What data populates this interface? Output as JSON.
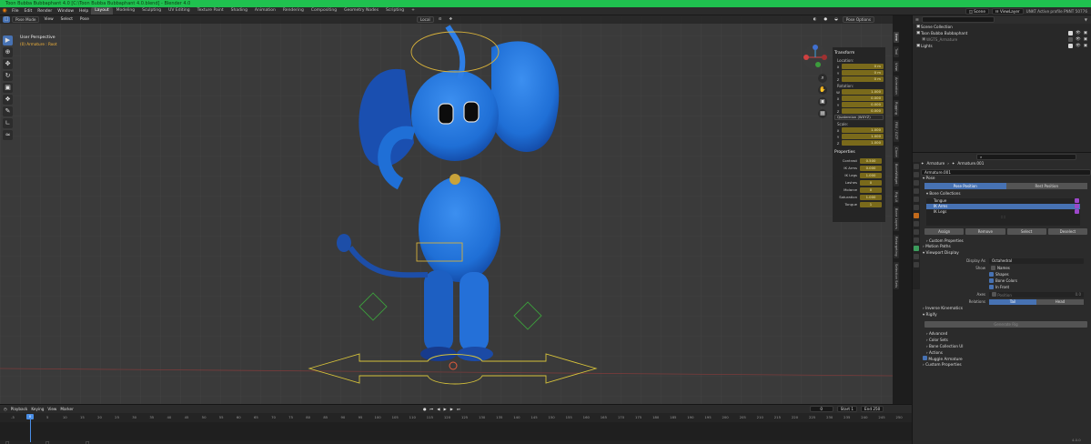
{
  "titlebar": {
    "title": "Toon Bubba Bubbaphant 4.0 [C:\\Toon Bubba Bubbaphant 4.0.blend] - Blender 4.0"
  },
  "menubar": {
    "menus": [
      "File",
      "Edit",
      "Render",
      "Window",
      "Help"
    ],
    "workspaces": [
      "Layout",
      "Modeling",
      "Sculpting",
      "UV Editing",
      "Texture Paint",
      "Shading",
      "Animation",
      "Rendering",
      "Compositing",
      "Geometry Nodes",
      "Scripting"
    ],
    "active_workspace": "Layout",
    "add_tab": "+",
    "scene": "Scene",
    "view_layer": "ViewLayer",
    "status": "UNKT Active profile PNNT 50776"
  },
  "viewport": {
    "mode": "Pose Mode",
    "header_menus": [
      "View",
      "Select",
      "Pose"
    ],
    "transform_orientation": "Local",
    "pose_options": "Pose Options",
    "perspective": "User Perspective",
    "active_object": "(0) Armature : Root",
    "tools": [
      "select",
      "cursor",
      "move",
      "rotate",
      "scale",
      "transform",
      "annotate",
      "measure",
      "relax"
    ]
  },
  "npanel": {
    "transform_title": "Transform",
    "location_label": "Location:",
    "location": [
      {
        "k": "X",
        "v": "0 m"
      },
      {
        "k": "Y",
        "v": "0 m"
      },
      {
        "k": "Z",
        "v": "0 m"
      }
    ],
    "rotation_label": "Rotation:",
    "rotation": [
      {
        "k": "W",
        "v": "1.000"
      },
      {
        "k": "X",
        "v": "0.000"
      },
      {
        "k": "Y",
        "v": "0.000"
      },
      {
        "k": "Z",
        "v": "0.000"
      }
    ],
    "rotation_mode": "Quaternion (WXYZ)",
    "scale_label": "Scale:",
    "scale": [
      {
        "k": "X",
        "v": "1.000"
      },
      {
        "k": "Y",
        "v": "1.000"
      },
      {
        "k": "Z",
        "v": "1.000"
      }
    ],
    "properties_title": "Properties",
    "properties": [
      {
        "k": "Contrast",
        "v": "0.500"
      },
      {
        "k": "IK Arms",
        "v": "0.000"
      },
      {
        "k": "IK Legs",
        "v": "1.000"
      },
      {
        "k": "Lashes",
        "v": "0"
      },
      {
        "k": "Molarce",
        "v": "0"
      },
      {
        "k": "Saturation",
        "v": "1.000"
      },
      {
        "k": "Tongue",
        "v": "1"
      }
    ],
    "tabs": [
      "Item",
      "Tool",
      "View",
      "Animation",
      "Rigging",
      "FBX / GLTF",
      "Clone",
      "BoneWidget",
      "Rig UI",
      "Bone Layers",
      "Retargeting",
      "Selection Sets"
    ],
    "active_tab": "Item"
  },
  "timeline": {
    "menus": [
      "Playback",
      "Keying",
      "View",
      "Marker"
    ],
    "current_frame": "0",
    "start_label": "Start",
    "start": "1",
    "end_label": "End",
    "end": "250",
    "ticks": [
      "-5",
      "0",
      "5",
      "10",
      "15",
      "20",
      "25",
      "30",
      "35",
      "40",
      "45",
      "50",
      "55",
      "60",
      "65",
      "70",
      "75",
      "80",
      "85",
      "90",
      "95",
      "100",
      "105",
      "110",
      "115",
      "120",
      "125",
      "130",
      "135",
      "140",
      "145",
      "150",
      "155",
      "160",
      "165",
      "170",
      "175",
      "180",
      "185",
      "190",
      "195",
      "200",
      "205",
      "210",
      "215",
      "220",
      "225",
      "230",
      "235",
      "240",
      "245",
      "250",
      "255"
    ],
    "playhead_label": "0",
    "version": "4.0.0"
  },
  "outliner": {
    "root": "Scene Collection",
    "items": [
      {
        "name": "Toon Bubba Bubbaphant",
        "icon": "collection-icon",
        "sub": false
      },
      {
        "name": "WGTS_Armature",
        "icon": "collection-icon",
        "sub": true
      },
      {
        "name": "Lights",
        "icon": "collection-icon",
        "sub": false
      }
    ]
  },
  "properties": {
    "breadcrumb": [
      "Armature",
      "Armature.001"
    ],
    "data_name": "Armature.001",
    "pose_section": "Pose",
    "pose_position": "Pose Position",
    "rest_position": "Rest Position",
    "bone_collections_title": "Bone Collections",
    "bone_collections": [
      "Tongue",
      "IK Arms",
      "IK Legs"
    ],
    "selected_collection": "IK Arms",
    "list_dots": "::::",
    "buttons": [
      "Assign",
      "Remove",
      "Select",
      "Deselect"
    ],
    "custom_properties": "Custom Properties",
    "motion_paths": "Motion Paths",
    "viewport_display": "Viewport Display",
    "display_as_label": "Display As",
    "display_as": "Octahedral",
    "show_label": "Show",
    "show_options": [
      {
        "label": "Names",
        "on": false
      },
      {
        "label": "Shapes",
        "on": true
      },
      {
        "label": "Bone Colors",
        "on": true
      },
      {
        "label": "In Front",
        "on": true
      }
    ],
    "axes_label": "Axes",
    "axes_value": "Position",
    "axes_num": "0.0",
    "relations_label": "Relations",
    "relations": [
      "Tail",
      "Head"
    ],
    "sections": [
      "Inverse Kinematics",
      "Rigify"
    ],
    "rigify_button": "Generate Rig",
    "rigify_subs": [
      "Advanced",
      "Color Sets",
      "Bone Collection UI",
      "Actions"
    ],
    "muggle": "Muggle Armature",
    "custom_properties2": "Custom Properties"
  },
  "colors": {
    "title_green": "#1fc14f",
    "accent_blue": "#4772b3",
    "field_yellow": "#7a6a1b",
    "character_blue": "#1f6fd6"
  }
}
